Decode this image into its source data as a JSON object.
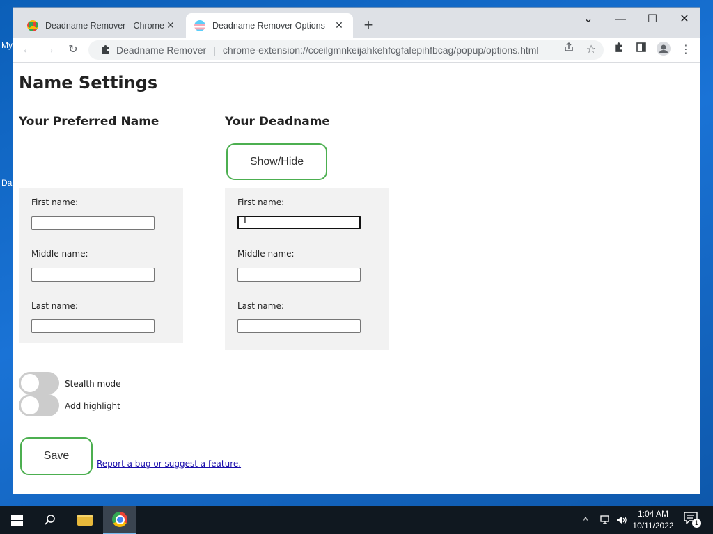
{
  "desktop": {
    "frag1": "My",
    "frag2": "Da"
  },
  "browser": {
    "tabs": [
      {
        "title": "Deadname Remover - Chrome W",
        "close": "✕"
      },
      {
        "title": "Deadname Remover Options",
        "close": "✕"
      }
    ],
    "new_tab": "+",
    "window_controls": {
      "tab_search": "⌄",
      "minimize": "—",
      "maximize": "☐",
      "close": "✕"
    },
    "nav": {
      "back": "←",
      "forward": "→",
      "reload": "↻"
    },
    "omnibox": {
      "extension_icon": "puzzle-icon",
      "site_name": "Deadname Remover",
      "url": "chrome-extension://cceilgmnkeijahkehfcgfalepihfbcag/popup/options.html"
    }
  },
  "page": {
    "title": "Name Settings",
    "preferred": {
      "heading": "Your Preferred Name",
      "first_label": "First name:",
      "middle_label": "Middle name:",
      "last_label": "Last name:",
      "first_value": "",
      "middle_value": "",
      "last_value": ""
    },
    "deadname": {
      "heading": "Your Deadname",
      "show_hide_label": "Show/Hide",
      "first_label": "First name:",
      "middle_label": "Middle name:",
      "last_label": "Last name:",
      "first_value": "",
      "middle_value": "",
      "last_value": ""
    },
    "toggles": [
      {
        "label": "Stealth mode",
        "on": false
      },
      {
        "label": "Add highlight",
        "on": false
      }
    ],
    "save_label": "Save",
    "report_link": "Report a bug or suggest a feature."
  },
  "taskbar": {
    "clock_time": "1:04 AM",
    "clock_date": "10/11/2022",
    "notification_count": "1",
    "tray_chevron": "^"
  },
  "colors": {
    "accent_green": "#4caf50",
    "panel_gray": "#f2f2f2",
    "toggle_off": "#cccccc",
    "link": "#1a0dab"
  }
}
